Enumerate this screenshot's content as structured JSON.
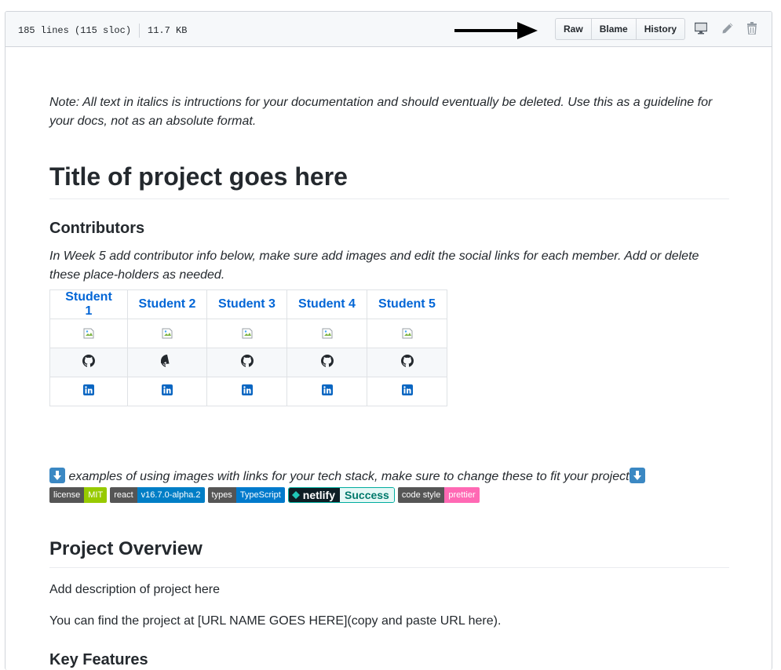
{
  "header": {
    "lines": "185 lines (115 sloc)",
    "size": "11.7 KB",
    "buttons": {
      "raw": "Raw",
      "blame": "Blame",
      "history": "History"
    }
  },
  "doc": {
    "note": "Note: All text in italics is intructions for your documentation and should eventually be deleted. Use this as a guideline for your docs, not as an absolute format.",
    "title": "Title of project goes here",
    "contributors_heading": "Contributors",
    "contributors_note": "In Week 5 add contributor info below, make sure add images and edit the social links for each member. Add or delete these place-holders as needed.",
    "students": [
      "Student 1",
      "Student 2",
      "Student 3",
      "Student 4",
      "Student 5"
    ],
    "tech_stack_note": "examples of using images with links for your tech stack, make sure to change these to fit your project",
    "badges": [
      {
        "left": "license",
        "right": "MIT",
        "color": "#97ca00"
      },
      {
        "left": "react",
        "right": "v16.7.0-alpha.2",
        "color": "#007ec6"
      },
      {
        "left": "types",
        "right": "TypeScript",
        "color": "#007acc"
      },
      {
        "left": "code style",
        "right": "prettier",
        "color": "#ff69b4"
      }
    ],
    "netlify": {
      "left": "netlify",
      "right": "Success"
    },
    "overview_heading": "Project Overview",
    "overview_text": "Add description of project here",
    "url_text": "You can find the project at [URL NAME GOES HERE](copy and paste URL here).",
    "features_heading": "Key Features"
  },
  "colors": {
    "link": "#0366d6",
    "border": "#d1d5da"
  }
}
